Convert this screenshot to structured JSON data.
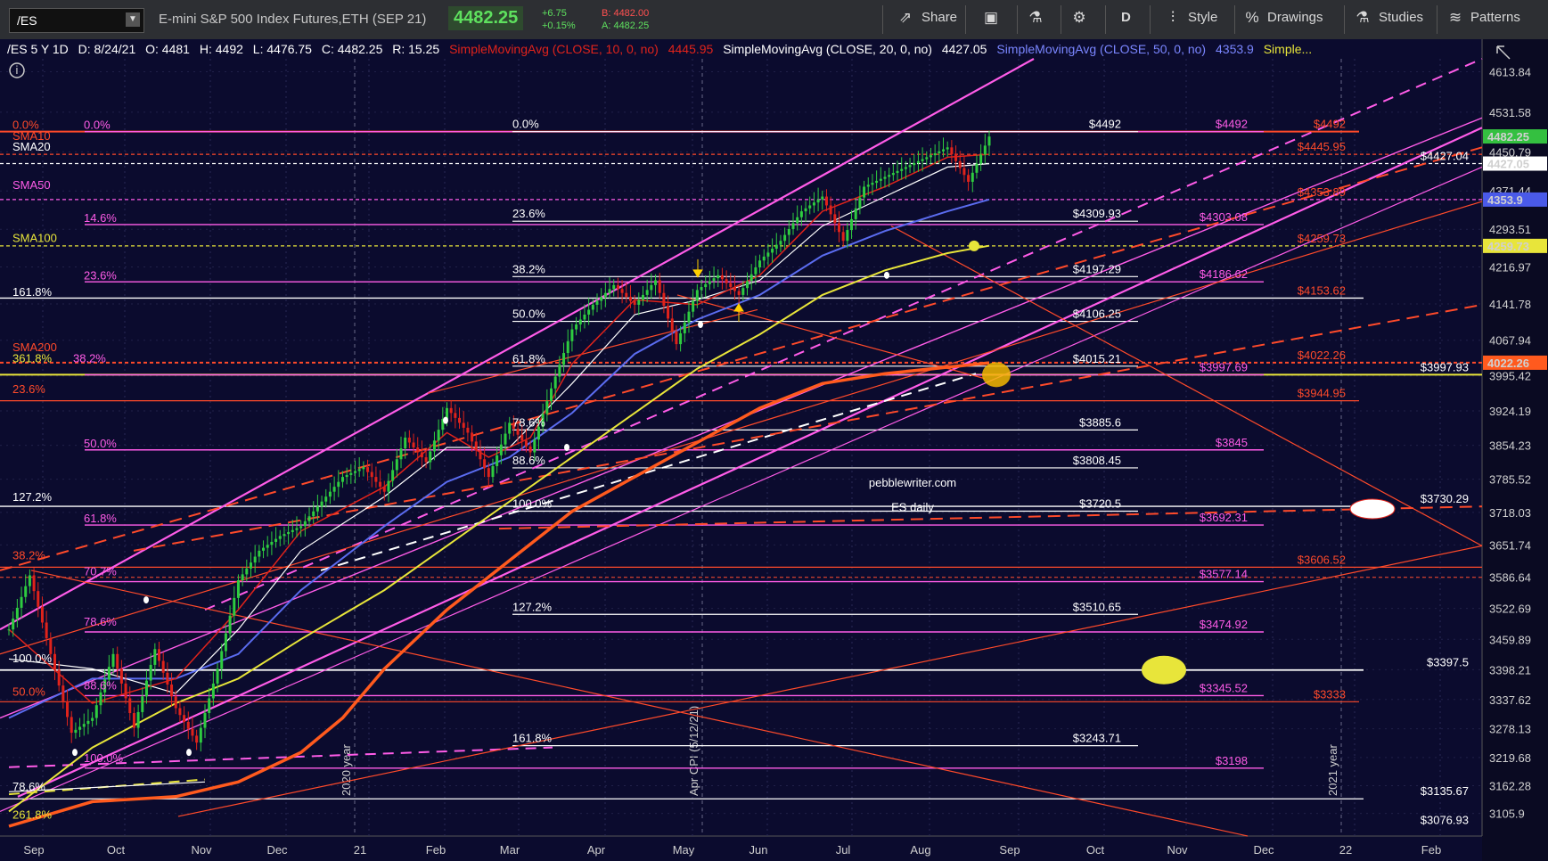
{
  "toolbar": {
    "symbol": "/ES",
    "instrument": "E-mini S&P 500 Index Futures,ETH (SEP 21)",
    "last": "4482.25",
    "change": "+6.75",
    "change_pct": "+0.15%",
    "bid": "B: 4482.00",
    "ask": "A: 4482.25",
    "share": "Share",
    "period": "D",
    "style": "Style",
    "drawings": "Drawings",
    "studies": "Studies",
    "patterns": "Patterns"
  },
  "studybar": {
    "symbol_period": "/ES 5 Y 1D",
    "date": "D: 8/24/21",
    "open": "O: 4481",
    "high": "H: 4492",
    "low": "L: 4476.75",
    "close": "C: 4482.25",
    "range": "R: 15.25",
    "sma10": "SimpleMovingAvg (CLOSE, 10, 0, no)",
    "sma10_val": "4445.95",
    "sma20": "SimpleMovingAvg (CLOSE, 20, 0, no)",
    "sma20_val": "4427.05",
    "sma50": "SimpleMovingAvg (CLOSE, 50, 0, no)",
    "sma50_val": "4353.9",
    "more": "Simple..."
  },
  "colors": {
    "background": "#0b0b2e",
    "sma10": "#e0231b",
    "sma20": "#ffffff",
    "sma50": "#5b6cf0",
    "sma100": "#e8e53a",
    "sma200": "#ff5a1e",
    "channel": "#ff5ce8",
    "orange_fib": "#ff4a2a",
    "white_fib": "#ffffff"
  },
  "watermark": {
    "line1": "pebblewriter.com",
    "line2": "ES daily"
  },
  "vertical_markers": [
    "2020 year",
    "Apr CPI (5/12/21)",
    "2021 year"
  ],
  "chart_data": {
    "type": "candlestick",
    "title": "",
    "ylim": [
      3060,
      4640
    ],
    "x_labels": [
      "Sep",
      "Oct",
      "Nov",
      "Dec",
      "21",
      "Feb",
      "Mar",
      "Apr",
      "May",
      "Jun",
      "Jul",
      "Aug",
      "Sep",
      "Oct",
      "Nov",
      "Dec",
      "22",
      "Feb"
    ],
    "y_ticks": [
      "4613.84",
      "4531.58",
      "4450.79",
      "4371.44",
      "4293.51",
      "4216.97",
      "4141.78",
      "4067.94",
      "3995.42",
      "3924.19",
      "3854.23",
      "3785.52",
      "3718.03",
      "3651.74",
      "3586.64",
      "3522.69",
      "3459.89",
      "3398.21",
      "3337.62",
      "3278.13",
      "3219.68",
      "3162.28",
      "3105.9"
    ],
    "price_flags": [
      {
        "label": "4482.25",
        "value": 4482.25,
        "bg": "#34c040",
        "fg": "#ffffff"
      },
      {
        "label": "4427.05",
        "value": 4427.05,
        "bg": "#ffffff",
        "fg": "#000000"
      },
      {
        "label": "4353.9",
        "value": 4353.9,
        "bg": "#4a5ae8",
        "fg": "#ffffff"
      },
      {
        "label": "4259.73",
        "value": 4259.73,
        "bg": "#e8e53a",
        "fg": "#000000"
      },
      {
        "label": "4022.26",
        "value": 4022.26,
        "bg": "#ff5a1e",
        "fg": "#ffffff"
      }
    ],
    "left_labels": [
      {
        "text": "0.0%",
        "value": 4492,
        "color": "#ff4a2a"
      },
      {
        "text": "0.0%",
        "value": 4492,
        "color": "#ff5ce8"
      },
      {
        "text": "SMA10",
        "value": 4470,
        "color": "#ff4a2a"
      },
      {
        "text": "SMA20",
        "value": 4448,
        "color": "#ffffff"
      },
      {
        "text": "SMA50",
        "value": 4370,
        "color": "#ff5ce8"
      },
      {
        "text": "14.6%",
        "value": 4303,
        "color": "#ff5ce8"
      },
      {
        "text": "SMA100",
        "value": 4262,
        "color": "#e8e53a"
      },
      {
        "text": "23.6%",
        "value": 4186,
        "color": "#ff5ce8"
      },
      {
        "text": "161.8%",
        "value": 4153,
        "color": "#ffffff"
      },
      {
        "text": "SMA200",
        "value": 4040,
        "color": "#ff4a2a"
      },
      {
        "text": "361.8%",
        "value": 4018,
        "color": "#e8e53a"
      },
      {
        "text": "38.2%",
        "value": 4018,
        "color": "#ff5ce8"
      },
      {
        "text": "23.6%",
        "value": 3955,
        "color": "#ff4a2a"
      },
      {
        "text": "50.0%",
        "value": 3845,
        "color": "#ff5ce8"
      },
      {
        "text": "127.2%",
        "value": 3736,
        "color": "#ffffff"
      },
      {
        "text": "61.8%",
        "value": 3692,
        "color": "#ff5ce8"
      },
      {
        "text": "38.2%",
        "value": 3617,
        "color": "#ff4a2a"
      },
      {
        "text": "70.7%",
        "value": 3585,
        "color": "#ff5ce8"
      },
      {
        "text": "78.6%",
        "value": 3482,
        "color": "#ff5ce8"
      },
      {
        "text": "100.0%",
        "value": 3408,
        "color": "#ffffff"
      },
      {
        "text": "88.6%",
        "value": 3353,
        "color": "#ff5ce8"
      },
      {
        "text": "50.0%",
        "value": 3340,
        "color": "#ff4a2a"
      },
      {
        "text": "100.0%",
        "value": 3205,
        "color": "#ff5ce8"
      },
      {
        "text": "78.6%",
        "value": 3147,
        "color": "#ffffff"
      },
      {
        "text": "261.8%",
        "value": 3090,
        "color": "#e8e53a"
      }
    ],
    "mid_fibs": [
      {
        "text": "0.0%",
        "value": 4492,
        "price": "$4492"
      },
      {
        "text": "23.6%",
        "value": 4309.93,
        "price": "$4309.93"
      },
      {
        "text": "38.2%",
        "value": 4197.29,
        "price": "$4197.29"
      },
      {
        "text": "50.0%",
        "value": 4106.25,
        "price": "$4106.25"
      },
      {
        "text": "61.8%",
        "value": 4015.21,
        "price": "$4015.21"
      },
      {
        "text": "78.6%",
        "value": 3885.6,
        "price": "$3885.6"
      },
      {
        "text": "88.6%",
        "value": 3808.45,
        "price": "$3808.45"
      },
      {
        "text": "100.0%",
        "value": 3720.5,
        "price": "$3720.5"
      },
      {
        "text": "127.2%",
        "value": 3510.65,
        "price": "$3510.65"
      },
      {
        "text": "161.8%",
        "value": 3243.71,
        "price": "$3243.71"
      }
    ],
    "pink_prices": [
      {
        "text": "$4492",
        "value": 4492
      },
      {
        "text": "$4303.08",
        "value": 4303.08
      },
      {
        "text": "$4186.62",
        "value": 4186.62
      },
      {
        "text": "$3997.69",
        "value": 3997.69
      },
      {
        "text": "$3845",
        "value": 3845
      },
      {
        "text": "$3692.31",
        "value": 3692.31
      },
      {
        "text": "$3577.14",
        "value": 3577.14
      },
      {
        "text": "$3474.92",
        "value": 3474.92
      },
      {
        "text": "$3345.52",
        "value": 3345.52
      },
      {
        "text": "$3198",
        "value": 3198
      }
    ],
    "orange_prices": [
      {
        "text": "$4492",
        "value": 4492
      },
      {
        "text": "$4445.95",
        "value": 4445.95
      },
      {
        "text": "$4353.89",
        "value": 4353.89
      },
      {
        "text": "$4259.73",
        "value": 4259.73
      },
      {
        "text": "$4153.62",
        "value": 4153.62
      },
      {
        "text": "$4022.26",
        "value": 4022.26
      },
      {
        "text": "$3944.95",
        "value": 3944.95
      },
      {
        "text": "$3606.52",
        "value": 3606.52
      },
      {
        "text": "$3333",
        "value": 3333
      }
    ],
    "white_prices": [
      {
        "text": "$4427.04",
        "value": 4427.04
      },
      {
        "text": "$3997.93",
        "value": 3997.93
      },
      {
        "text": "$3730.29",
        "value": 3730.29
      },
      {
        "text": "$3397.5",
        "value": 3397.5
      },
      {
        "text": "$3135.67",
        "value": 3135.67
      },
      {
        "text": "$3076.93",
        "value": 3076.93
      }
    ],
    "price_path": [
      [
        0,
        3480
      ],
      [
        5,
        3590
      ],
      [
        10,
        3430
      ],
      [
        15,
        3270
      ],
      [
        20,
        3300
      ],
      [
        25,
        3430
      ],
      [
        30,
        3280
      ],
      [
        35,
        3440
      ],
      [
        40,
        3320
      ],
      [
        45,
        3250
      ],
      [
        50,
        3400
      ],
      [
        55,
        3580
      ],
      [
        60,
        3640
      ],
      [
        65,
        3670
      ],
      [
        70,
        3690
      ],
      [
        75,
        3740
      ],
      [
        80,
        3790
      ],
      [
        85,
        3810
      ],
      [
        90,
        3760
      ],
      [
        95,
        3870
      ],
      [
        100,
        3820
      ],
      [
        105,
        3930
      ],
      [
        110,
        3880
      ],
      [
        115,
        3790
      ],
      [
        120,
        3900
      ],
      [
        125,
        3840
      ],
      [
        130,
        3970
      ],
      [
        135,
        4090
      ],
      [
        140,
        4140
      ],
      [
        145,
        4180
      ],
      [
        150,
        4140
      ],
      [
        155,
        4190
      ],
      [
        160,
        4060
      ],
      [
        165,
        4170
      ],
      [
        170,
        4200
      ],
      [
        175,
        4160
      ],
      [
        180,
        4230
      ],
      [
        185,
        4270
      ],
      [
        190,
        4330
      ],
      [
        195,
        4360
      ],
      [
        200,
        4270
      ],
      [
        205,
        4380
      ],
      [
        210,
        4400
      ],
      [
        215,
        4420
      ],
      [
        220,
        4440
      ],
      [
        225,
        4460
      ],
      [
        230,
        4390
      ],
      [
        235,
        4482
      ]
    ],
    "sma10": [
      [
        0,
        3480
      ],
      [
        20,
        3330
      ],
      [
        40,
        3380
      ],
      [
        55,
        3520
      ],
      [
        70,
        3680
      ],
      [
        90,
        3770
      ],
      [
        105,
        3880
      ],
      [
        115,
        3830
      ],
      [
        125,
        3870
      ],
      [
        135,
        4020
      ],
      [
        150,
        4150
      ],
      [
        165,
        4140
      ],
      [
        180,
        4200
      ],
      [
        195,
        4330
      ],
      [
        210,
        4380
      ],
      [
        225,
        4440
      ],
      [
        235,
        4446
      ]
    ],
    "sma20": [
      [
        0,
        3420
      ],
      [
        20,
        3400
      ],
      [
        40,
        3350
      ],
      [
        55,
        3480
      ],
      [
        70,
        3640
      ],
      [
        90,
        3750
      ],
      [
        105,
        3850
      ],
      [
        120,
        3850
      ],
      [
        135,
        3980
      ],
      [
        150,
        4120
      ],
      [
        165,
        4150
      ],
      [
        180,
        4190
      ],
      [
        195,
        4300
      ],
      [
        210,
        4360
      ],
      [
        225,
        4420
      ],
      [
        235,
        4427
      ]
    ],
    "sma50": [
      [
        0,
        3300
      ],
      [
        20,
        3380
      ],
      [
        40,
        3380
      ],
      [
        55,
        3430
      ],
      [
        70,
        3560
      ],
      [
        90,
        3690
      ],
      [
        105,
        3780
      ],
      [
        120,
        3830
      ],
      [
        135,
        3920
      ],
      [
        150,
        4040
      ],
      [
        165,
        4110
      ],
      [
        180,
        4160
      ],
      [
        195,
        4240
      ],
      [
        210,
        4290
      ],
      [
        225,
        4330
      ],
      [
        235,
        4354
      ]
    ],
    "sma100": [
      [
        0,
        3110
      ],
      [
        20,
        3240
      ],
      [
        40,
        3330
      ],
      [
        55,
        3380
      ],
      [
        70,
        3460
      ],
      [
        90,
        3560
      ],
      [
        105,
        3650
      ],
      [
        120,
        3740
      ],
      [
        135,
        3830
      ],
      [
        150,
        3920
      ],
      [
        165,
        4010
      ],
      [
        180,
        4080
      ],
      [
        195,
        4160
      ],
      [
        210,
        4210
      ],
      [
        225,
        4245
      ],
      [
        235,
        4260
      ]
    ],
    "sma200": [
      [
        0,
        3080
      ],
      [
        20,
        3130
      ],
      [
        40,
        3140
      ],
      [
        55,
        3170
      ],
      [
        70,
        3230
      ],
      [
        80,
        3300
      ],
      [
        90,
        3400
      ],
      [
        105,
        3520
      ],
      [
        120,
        3620
      ],
      [
        135,
        3720
      ],
      [
        150,
        3790
      ],
      [
        165,
        3860
      ],
      [
        180,
        3930
      ],
      [
        195,
        3980
      ],
      [
        210,
        4000
      ],
      [
        235,
        4022
      ]
    ]
  }
}
